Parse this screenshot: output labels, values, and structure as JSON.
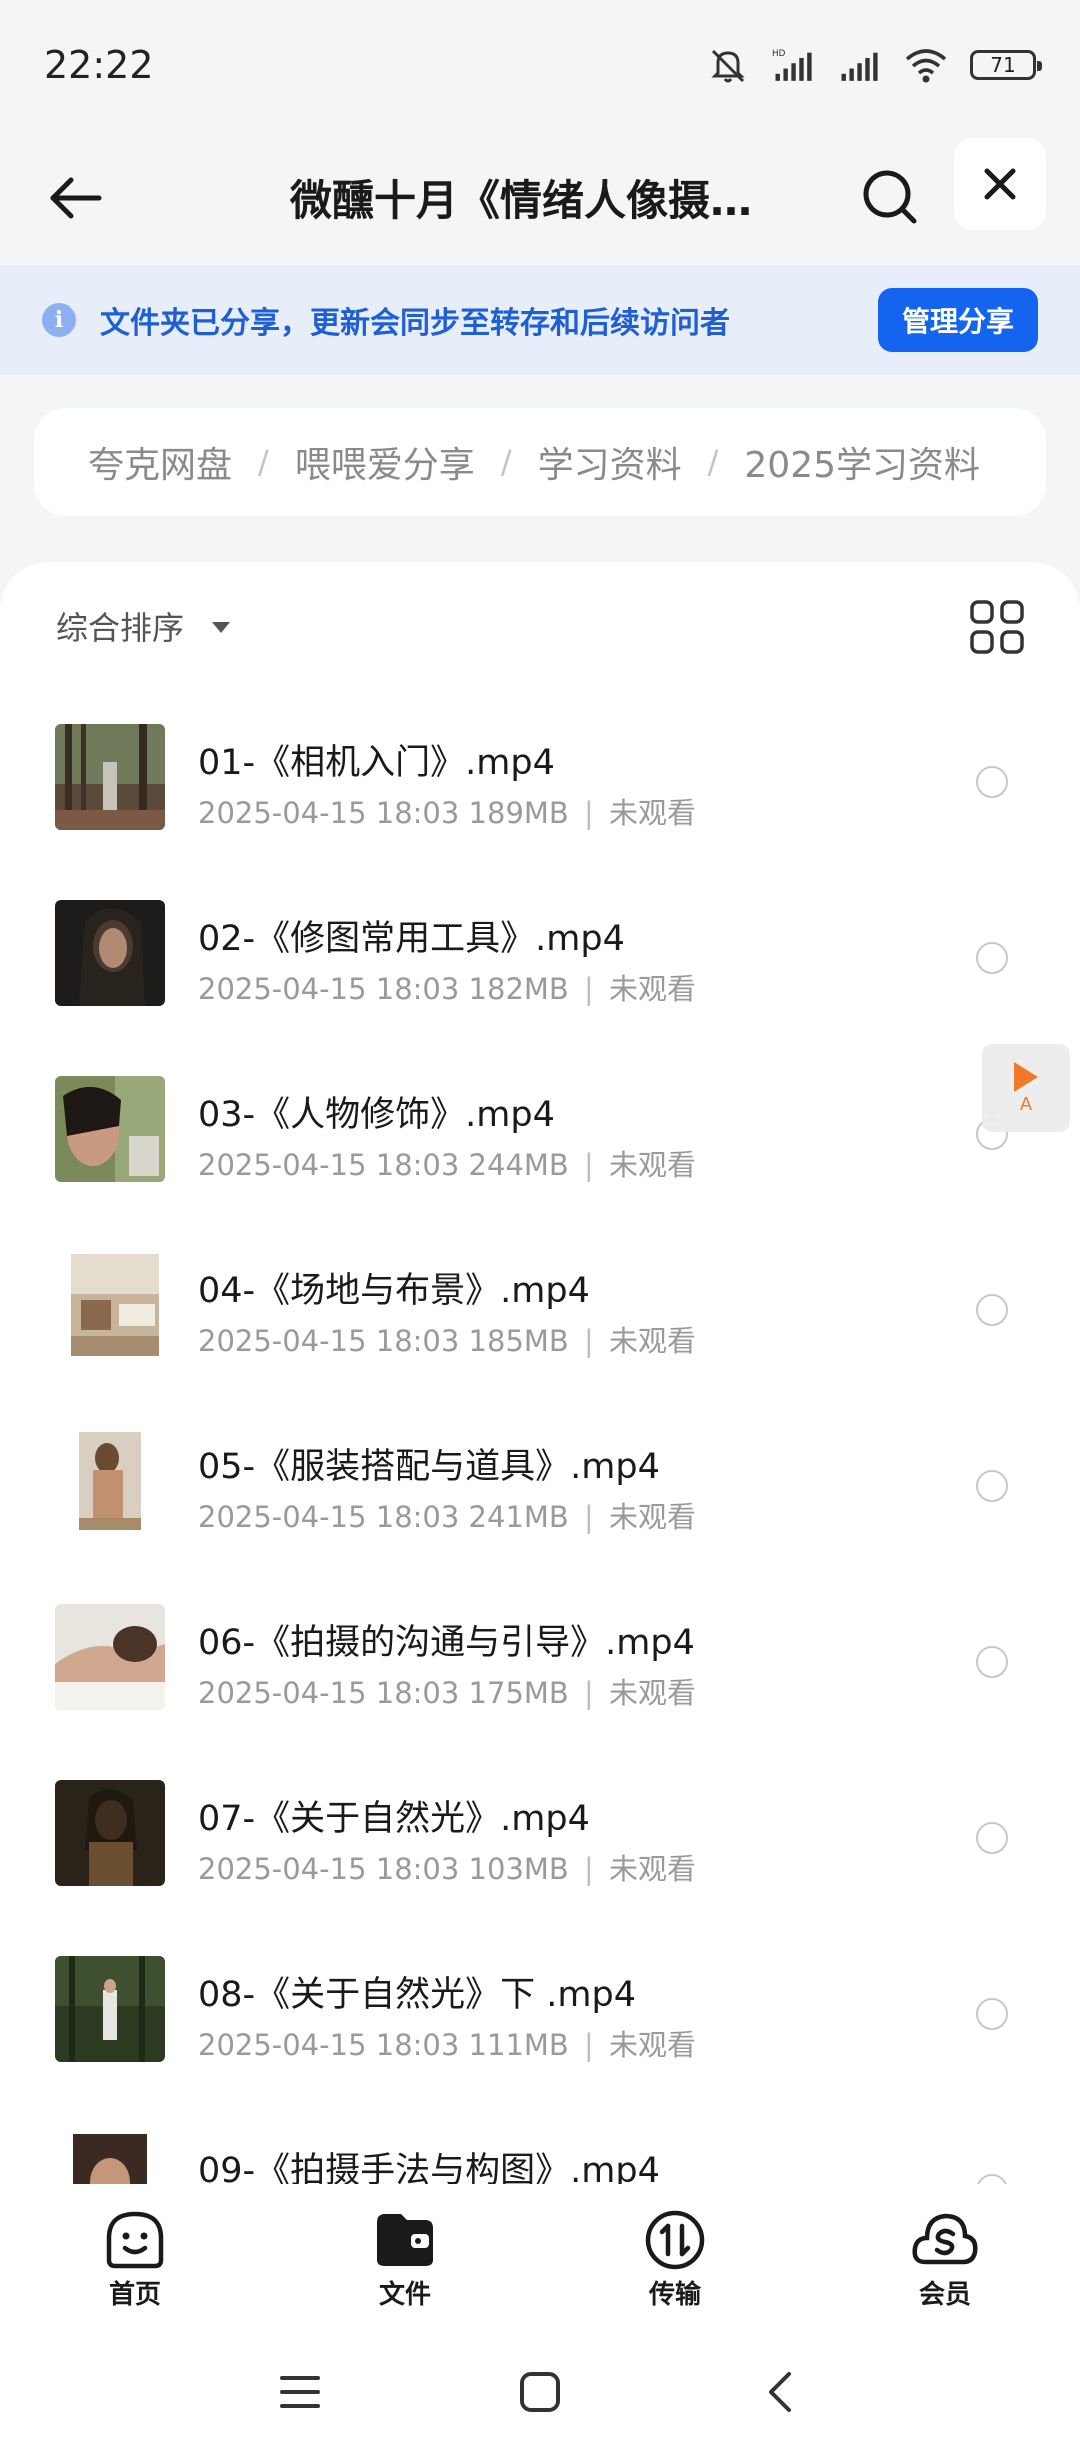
{
  "status_bar": {
    "time": "22:22",
    "battery": "71"
  },
  "header": {
    "title": "微醺十月《情绪人像摄…"
  },
  "share_banner": {
    "info_icon": "i",
    "text": "文件夹已分享，更新会同步至转存和后续访问者",
    "button": "管理分享"
  },
  "breadcrumb": {
    "items": [
      "夸克网盘",
      "喂喂爱分享",
      "学习资料",
      "2025学习资料"
    ],
    "separator": "/"
  },
  "sort": {
    "label": "综合排序"
  },
  "files": [
    {
      "name": "01-《相机入门》.mp4",
      "date": "2025-04-15 18:03",
      "size": "189MB",
      "status": "未观看"
    },
    {
      "name": "02-《修图常用工具》.mp4",
      "date": "2025-04-15 18:03",
      "size": "182MB",
      "status": "未观看"
    },
    {
      "name": "03-《人物修饰》.mp4",
      "date": "2025-04-15 18:03",
      "size": "244MB",
      "status": "未观看"
    },
    {
      "name": "04-《场地与布景》.mp4",
      "date": "2025-04-15 18:03",
      "size": "185MB",
      "status": "未观看"
    },
    {
      "name": "05-《服装搭配与道具》.mp4",
      "date": "2025-04-15 18:03",
      "size": "241MB",
      "status": "未观看"
    },
    {
      "name": "06-《拍摄的沟通与引导》.mp4",
      "date": "2025-04-15 18:03",
      "size": "175MB",
      "status": "未观看"
    },
    {
      "name": "07-《关于自然光》.mp4",
      "date": "2025-04-15 18:03",
      "size": "103MB",
      "status": "未观看"
    },
    {
      "name": "08-《关于自然光》下 .mp4",
      "date": "2025-04-15 18:03",
      "size": "111MB",
      "status": "未观看"
    },
    {
      "name": "09-《拍摄手法与构图》.mp4",
      "date": "",
      "size": "",
      "status": ""
    }
  ],
  "meta_separator": "|",
  "float_player": {
    "label": "A"
  },
  "bottom_nav": [
    {
      "label": "首页",
      "icon": "smiley-home-icon"
    },
    {
      "label": "文件",
      "icon": "folder-icon"
    },
    {
      "label": "传输",
      "icon": "transfer-icon"
    },
    {
      "label": "会员",
      "icon": "member-icon"
    }
  ],
  "colors": {
    "accent": "#1464f0",
    "banner_bg": "#e8eef9",
    "banner_text": "#1f5fd6",
    "player": "#f07a2a"
  }
}
